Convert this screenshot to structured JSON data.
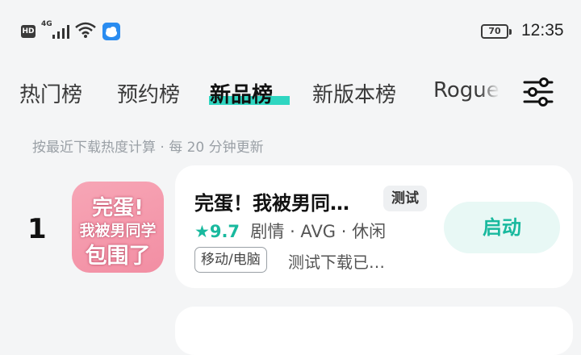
{
  "status_bar": {
    "hd": "HD",
    "network": "4G",
    "battery": "70",
    "time": "12:35"
  },
  "tabs": [
    {
      "label": "热门榜"
    },
    {
      "label": "预约榜"
    },
    {
      "label": "新品榜",
      "active": true
    },
    {
      "label": "新版本榜"
    },
    {
      "label": "Rogue"
    }
  ],
  "hint": "按最近下载热度计算 · 每 20 分钟更新",
  "apps": [
    {
      "rank": "1",
      "icon_lines": [
        "完蛋!",
        "我被男同学",
        "包围了"
      ],
      "title": "完蛋！我被男同…",
      "tag": "测试",
      "rating": "9.7",
      "genres": "剧情 · AVG · 休闲",
      "platform": "移动/电脑",
      "note": "测试下载已…",
      "action": "启动"
    }
  ],
  "colors": {
    "accent": "#19b99e",
    "tab_highlight": "#2fd6c1",
    "icon_bg": "#f49bb0"
  },
  "icons": [
    "hd-icon",
    "signal-icon",
    "wifi-icon",
    "app-notification-icon",
    "battery-icon",
    "filter-icon",
    "star-icon"
  ]
}
